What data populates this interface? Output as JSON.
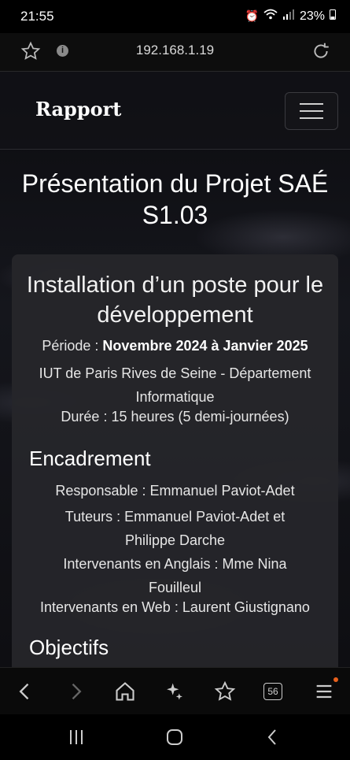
{
  "status": {
    "time": "21:55",
    "battery": "23%"
  },
  "urlbar": {
    "url": "192.168.1.19",
    "info_glyph": "i"
  },
  "navbar": {
    "brand": "Rapport"
  },
  "page": {
    "title": "Présentation du Projet SAÉ S1.03"
  },
  "card": {
    "heading": "Installation d’un poste pour le développement",
    "periode_label": "Période : ",
    "periode_value": "Novembre 2024 à Janvier 2025",
    "institution": "IUT de Paris Rives de Seine - Département Informatique",
    "duree": "Durée : 15 heures (5 demi-journées)",
    "encadrement_title": "Encadrement",
    "responsable": "Responsable : Emmanuel Paviot-Adet",
    "tuteurs": "Tuteurs : Emmanuel Paviot-Adet et Philippe Darche",
    "anglais": "Intervenants en Anglais : Mme Nina Fouilleul",
    "web": "Intervenants en Web : Laurent Giustignano",
    "objectifs_title": "Objectifs"
  },
  "bottom_nav": {
    "tabs_count": "56"
  },
  "colors": {
    "notification_dot": "#e8601c"
  }
}
